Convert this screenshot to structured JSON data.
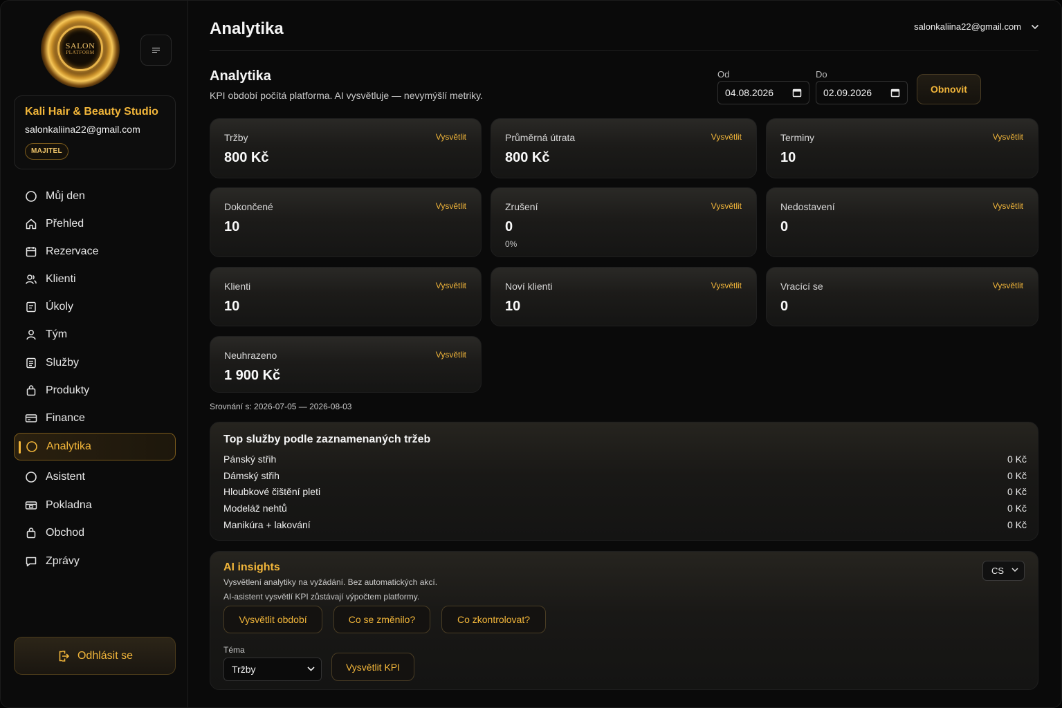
{
  "logo": {
    "line1": "SALON",
    "line2": "PLATFORM"
  },
  "studio": {
    "name": "Kali Hair & Beauty Studio",
    "email": "salonkaliina22@gmail.com",
    "role": "MAJITEL"
  },
  "nav": [
    {
      "label": "Můj den",
      "icon": "circle-icon"
    },
    {
      "label": "Přehled",
      "icon": "home-icon"
    },
    {
      "label": "Rezervace",
      "icon": "calendar-icon"
    },
    {
      "label": "Klienti",
      "icon": "users-icon"
    },
    {
      "label": "Úkoly",
      "icon": "task-icon"
    },
    {
      "label": "Tým",
      "icon": "user-icon"
    },
    {
      "label": "Služby",
      "icon": "list-icon"
    },
    {
      "label": "Produkty",
      "icon": "bag-icon"
    },
    {
      "label": "Finance",
      "icon": "card-icon"
    },
    {
      "label": "Analytika",
      "icon": "circle-icon",
      "active": true
    },
    {
      "label": "Asistent",
      "icon": "circle-icon"
    },
    {
      "label": "Pokladna",
      "icon": "register-icon"
    },
    {
      "label": "Obchod",
      "icon": "bag-icon"
    },
    {
      "label": "Zprávy",
      "icon": "message-icon"
    }
  ],
  "logout_label": "Odhlásit se",
  "header": {
    "title": "Analytika",
    "user_email": "salonkaliina22@gmail.com"
  },
  "section": {
    "title": "Analytika",
    "subtitle": "KPI období počítá platforma. AI vysvětluje — nevymýšlí metriky."
  },
  "filters": {
    "from_label": "Od",
    "from_value": "04.08.2026",
    "to_label": "Do",
    "to_value": "02.09.2026",
    "refresh_label": "Obnovit"
  },
  "explain_label": "Vysvětlit",
  "kpis": [
    {
      "label": "Tržby",
      "value": "800 Kč"
    },
    {
      "label": "Průměrná útrata",
      "value": "800 Kč"
    },
    {
      "label": "Terminy",
      "value": "10"
    },
    {
      "label": "Dokončené",
      "value": "10"
    },
    {
      "label": "Zrušení",
      "value": "0",
      "sub": "0%"
    },
    {
      "label": "Nedostavení",
      "value": "0"
    },
    {
      "label": "Klienti",
      "value": "10"
    },
    {
      "label": "Noví klienti",
      "value": "10"
    },
    {
      "label": "Vracící se",
      "value": "0"
    },
    {
      "label": "Neuhrazeno",
      "value": "1 900 Kč"
    }
  ],
  "comparison": "Srovnání s: 2026-07-05 — 2026-08-03",
  "top_services": {
    "title": "Top služby podle zaznamenaných tržeb",
    "rows": [
      {
        "name": "Pánský střih",
        "amount": "0  Kč"
      },
      {
        "name": "Dámský střih",
        "amount": "0  Kč"
      },
      {
        "name": "Hloubkové čištění pleti",
        "amount": "0  Kč"
      },
      {
        "name": "Modeláž nehtů",
        "amount": "0  Kč"
      },
      {
        "name": "Manikúra + lakování",
        "amount": "0  Kč"
      }
    ]
  },
  "ai": {
    "title": "AI insights",
    "line1": "Vysvětlení analytiky na vyžádání. Bez automatických akcí.",
    "line2": "AI-asistent vysvětlí KPI zůstávají výpočtem platformy.",
    "language": "CS",
    "buttons": [
      "Vysvětlit období",
      "Co se změnilo?",
      "Co zkontrolovat?"
    ],
    "topic_label": "Téma",
    "topic_value": "Tržby",
    "explain_kpi_label": "Vysvětlit KPI"
  },
  "colors": {
    "accent": "#f2b63a",
    "background": "#0a0a0a",
    "card": "#1c1b19"
  }
}
